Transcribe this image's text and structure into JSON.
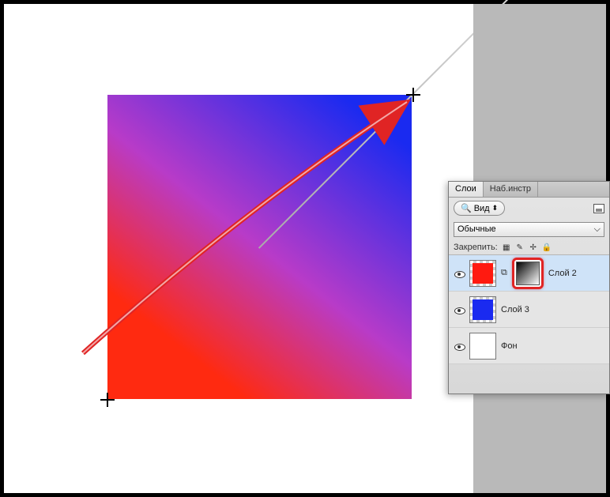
{
  "panel": {
    "tabs": {
      "layers": "Слои",
      "tools": "Наб.инстр"
    },
    "filter_label": "Вид",
    "blend_mode": "Обычные",
    "lock_label": "Закрепить:"
  },
  "layers": [
    {
      "name": "Слой 2"
    },
    {
      "name": "Слой 3"
    },
    {
      "name": "Фон"
    }
  ]
}
